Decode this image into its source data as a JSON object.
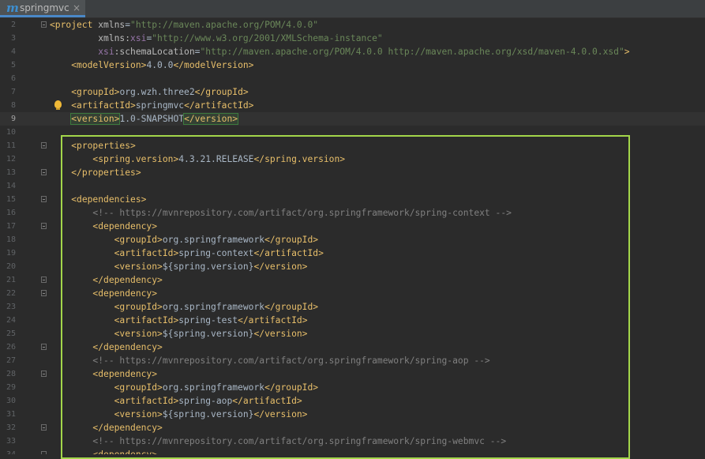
{
  "tab": {
    "icon_name": "maven-m-icon",
    "icon_glyph": "m",
    "label": "springmvc",
    "close_glyph": "×"
  },
  "colors": {
    "background": "#2b2b2b",
    "tag": "#e8bf6a",
    "text": "#a9b7c6",
    "attribute_value": "#6a8759",
    "comment": "#808080",
    "highlight_box": "#a3d64a"
  },
  "editor": {
    "current_line": 9,
    "lines": [
      {
        "num": "2",
        "fold": true,
        "tokens": [
          [
            "tg",
            "<project "
          ],
          [
            "at",
            "xmlns"
          ],
          [
            "tx",
            "="
          ],
          [
            "av",
            "\"http://maven.apache.org/POM/4.0.0\""
          ]
        ]
      },
      {
        "num": "3",
        "tokens": [
          [
            "tx",
            "         "
          ],
          [
            "at",
            "xmlns:"
          ],
          [
            "ns",
            "xsi"
          ],
          [
            "tx",
            "="
          ],
          [
            "av",
            "\"http://www.w3.org/2001/XMLSchema-instance\""
          ]
        ]
      },
      {
        "num": "4",
        "tokens": [
          [
            "tx",
            "         "
          ],
          [
            "ns",
            "xsi"
          ],
          [
            "at",
            ":schemaLocation"
          ],
          [
            "tx",
            "="
          ],
          [
            "av",
            "\"http://maven.apache.org/POM/4.0.0 http://maven.apache.org/xsd/maven-4.0.0.xsd\""
          ],
          [
            "tg",
            ">"
          ]
        ]
      },
      {
        "num": "5",
        "tokens": [
          [
            "tx",
            "    "
          ],
          [
            "tg",
            "<modelVersion>"
          ],
          [
            "tx",
            "4.0.0"
          ],
          [
            "tg",
            "</modelVersion>"
          ]
        ]
      },
      {
        "num": "6",
        "tokens": []
      },
      {
        "num": "7",
        "tokens": [
          [
            "tx",
            "    "
          ],
          [
            "tg",
            "<groupId>"
          ],
          [
            "tx",
            "org.wzh.three2"
          ],
          [
            "tg",
            "</groupId>"
          ]
        ]
      },
      {
        "num": "8",
        "bulb": true,
        "tokens": [
          [
            "tx",
            "    "
          ],
          [
            "tg",
            "<artifactId>"
          ],
          [
            "tx",
            "springmvc"
          ],
          [
            "tg",
            "</artifactId>"
          ]
        ]
      },
      {
        "num": "9",
        "current": true,
        "tokens": [
          [
            "tx",
            "    "
          ],
          [
            "box",
            "<version>"
          ],
          [
            "tx",
            "1.0-SNAPSHOT"
          ],
          [
            "box",
            "</version>"
          ],
          [
            "caret",
            ""
          ]
        ]
      },
      {
        "num": "10",
        "tokens": []
      },
      {
        "num": "11",
        "fold": true,
        "tokens": [
          [
            "tx",
            "    "
          ],
          [
            "tg",
            "<properties>"
          ]
        ]
      },
      {
        "num": "12",
        "tokens": [
          [
            "tx",
            "        "
          ],
          [
            "tg",
            "<spring.version>"
          ],
          [
            "tx",
            "4.3.21.RELEASE"
          ],
          [
            "tg",
            "</spring.version>"
          ]
        ]
      },
      {
        "num": "13",
        "fold": true,
        "tokens": [
          [
            "tx",
            "    "
          ],
          [
            "tg",
            "</properties>"
          ]
        ]
      },
      {
        "num": "14",
        "tokens": []
      },
      {
        "num": "15",
        "fold": true,
        "tokens": [
          [
            "tx",
            "    "
          ],
          [
            "tg",
            "<dependencies>"
          ]
        ]
      },
      {
        "num": "16",
        "tokens": [
          [
            "tx",
            "        "
          ],
          [
            "cm",
            "<!-- https://mvnrepository.com/artifact/org.springframework/spring-context -->"
          ]
        ]
      },
      {
        "num": "17",
        "fold": true,
        "tokens": [
          [
            "tx",
            "        "
          ],
          [
            "tg",
            "<dependency>"
          ]
        ]
      },
      {
        "num": "18",
        "tokens": [
          [
            "tx",
            "            "
          ],
          [
            "tg",
            "<groupId>"
          ],
          [
            "tx",
            "org.springframework"
          ],
          [
            "tg",
            "</groupId>"
          ]
        ]
      },
      {
        "num": "19",
        "tokens": [
          [
            "tx",
            "            "
          ],
          [
            "tg",
            "<artifactId>"
          ],
          [
            "tx",
            "spring-context"
          ],
          [
            "tg",
            "</artifactId>"
          ]
        ]
      },
      {
        "num": "20",
        "tokens": [
          [
            "tx",
            "            "
          ],
          [
            "tg",
            "<version>"
          ],
          [
            "tx",
            "${spring.version}"
          ],
          [
            "tg",
            "</version>"
          ]
        ]
      },
      {
        "num": "21",
        "fold": true,
        "tokens": [
          [
            "tx",
            "        "
          ],
          [
            "tg",
            "</dependency>"
          ]
        ]
      },
      {
        "num": "22",
        "fold": true,
        "tokens": [
          [
            "tx",
            "        "
          ],
          [
            "tg",
            "<dependency>"
          ]
        ]
      },
      {
        "num": "23",
        "tokens": [
          [
            "tx",
            "            "
          ],
          [
            "tg",
            "<groupId>"
          ],
          [
            "tx",
            "org.springframework"
          ],
          [
            "tg",
            "</groupId>"
          ]
        ]
      },
      {
        "num": "24",
        "tokens": [
          [
            "tx",
            "            "
          ],
          [
            "tg",
            "<artifactId>"
          ],
          [
            "tx",
            "spring-test"
          ],
          [
            "tg",
            "</artifactId>"
          ]
        ]
      },
      {
        "num": "25",
        "tokens": [
          [
            "tx",
            "            "
          ],
          [
            "tg",
            "<version>"
          ],
          [
            "tx",
            "${spring.version}"
          ],
          [
            "tg",
            "</version>"
          ]
        ]
      },
      {
        "num": "26",
        "fold": true,
        "tokens": [
          [
            "tx",
            "        "
          ],
          [
            "tg",
            "</dependency>"
          ]
        ]
      },
      {
        "num": "27",
        "tokens": [
          [
            "tx",
            "        "
          ],
          [
            "cm",
            "<!-- https://mvnrepository.com/artifact/org.springframework/spring-aop -->"
          ]
        ]
      },
      {
        "num": "28",
        "fold": true,
        "tokens": [
          [
            "tx",
            "        "
          ],
          [
            "tg",
            "<dependency>"
          ]
        ]
      },
      {
        "num": "29",
        "tokens": [
          [
            "tx",
            "            "
          ],
          [
            "tg",
            "<groupId>"
          ],
          [
            "tx",
            "org.springframework"
          ],
          [
            "tg",
            "</groupId>"
          ]
        ]
      },
      {
        "num": "30",
        "tokens": [
          [
            "tx",
            "            "
          ],
          [
            "tg",
            "<artifactId>"
          ],
          [
            "tx",
            "spring-aop"
          ],
          [
            "tg",
            "</artifactId>"
          ]
        ]
      },
      {
        "num": "31",
        "tokens": [
          [
            "tx",
            "            "
          ],
          [
            "tg",
            "<version>"
          ],
          [
            "tx",
            "${spring.version}"
          ],
          [
            "tg",
            "</version>"
          ]
        ]
      },
      {
        "num": "32",
        "fold": true,
        "tokens": [
          [
            "tx",
            "        "
          ],
          [
            "tg",
            "</dependency>"
          ]
        ]
      },
      {
        "num": "33",
        "tokens": [
          [
            "tx",
            "        "
          ],
          [
            "cm",
            "<!-- https://mvnrepository.com/artifact/org.springframework/spring-webmvc -->"
          ]
        ]
      },
      {
        "num": "34",
        "fold": true,
        "tokens": [
          [
            "tx",
            "        "
          ],
          [
            "tg",
            "<dependency>"
          ]
        ]
      }
    ]
  }
}
